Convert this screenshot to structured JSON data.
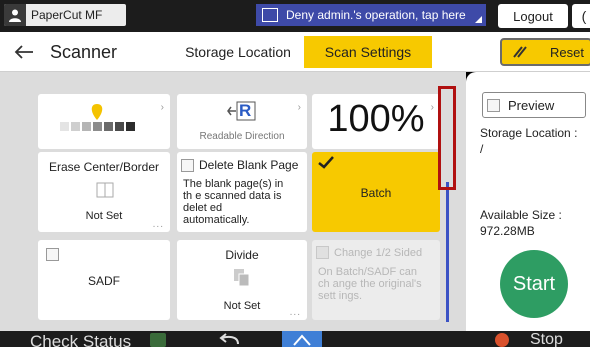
{
  "sysbar": {
    "user_name": "PaperCut MF",
    "notice": "Deny admin.'s operation, tap here",
    "logout_label": "Logout",
    "extra_glyph": "("
  },
  "header": {
    "title": "Scanner",
    "tabs": [
      {
        "label": "Storage Location",
        "active": false
      },
      {
        "label": "Scan Settings",
        "active": true
      }
    ],
    "reset_label": "Reset"
  },
  "settings": {
    "density": {
      "level_index": 3,
      "levels": 7
    },
    "readable_direction": {
      "label": "Readable Direction",
      "icon_letter": "R"
    },
    "zoom": {
      "value": "100%"
    },
    "erase": {
      "title": "Erase Center/Border",
      "value": "Not Set"
    },
    "delete_blank": {
      "title": "Delete Blank Page",
      "desc": "The blank page(s) in th e scanned data is delet ed automatically.",
      "checked": false
    },
    "batch": {
      "title": "Batch",
      "checked": true
    },
    "sadf": {
      "title": "SADF",
      "checked": false
    },
    "divide": {
      "title": "Divide",
      "value": "Not Set"
    },
    "change_sided": {
      "title": "Change 1/2 Sided",
      "desc": "On Batch/SADF can ch ange the original's sett ings.",
      "disabled": true
    }
  },
  "right_panel": {
    "preview_label": "Preview",
    "storage_location_label": "Storage Location :",
    "storage_location_value": "/",
    "available_size_label": "Available Size :",
    "available_size_value": "972.28MB",
    "start_label": "Start"
  },
  "bottombar": {
    "check_status": "Check Status",
    "stop_label": "Stop"
  },
  "colors": {
    "accent": "#f7c900",
    "start": "#2e9d63",
    "notice_bg": "#3e4aa8",
    "highlight": "#b01010"
  }
}
